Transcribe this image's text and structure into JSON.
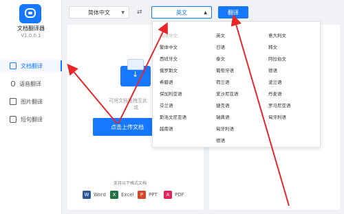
{
  "app": {
    "title": "文档翻译器",
    "version": "V1.0.0.1"
  },
  "sidebar": {
    "items": [
      {
        "label": "文档翻译",
        "icon": "document-icon",
        "active": true
      },
      {
        "label": "语音翻译",
        "icon": "microphone-icon",
        "active": false
      },
      {
        "label": "图片翻译",
        "icon": "image-icon",
        "active": false
      },
      {
        "label": "短句翻译",
        "icon": "text-icon",
        "active": false
      }
    ]
  },
  "toolbar": {
    "source_lang": "简体中文",
    "target_lang": "英文",
    "swap_icon": "swap-arrows-icon",
    "translate_label": "翻译"
  },
  "upload": {
    "hint": "可将文档拖拽至此",
    "hint_suffix": "或",
    "button_label": "点击上传文档",
    "formats_title": "支持以下格式文档",
    "formats": [
      {
        "label": "Word",
        "color": "#2b579a",
        "glyph": "W"
      },
      {
        "label": "Excel",
        "color": "#217346",
        "glyph": "X"
      },
      {
        "label": "PPT",
        "color": "#d24726",
        "glyph": "P"
      },
      {
        "label": "PDF",
        "color": "#e0245e",
        "glyph": "A"
      }
    ]
  },
  "dropdown": {
    "columns": [
      [
        "简体中文",
        "繁体中文",
        "西班牙文",
        "俄罗斯文",
        "希腊语",
        "保加利亚语",
        "芬兰语",
        "斯洛文尼亚语",
        "越南语"
      ],
      [
        "英文",
        "日语",
        "泰文",
        "葡萄牙语",
        "荷兰语",
        "爱沙尼亚语",
        "捷克语",
        "瑞典语",
        "匈牙利语",
        "德语"
      ],
      [
        "意大利文",
        "韩文",
        "阿拉伯文",
        "德语",
        "波兰语",
        "丹麦语",
        "罗马尼亚语",
        "匈牙利语"
      ]
    ]
  },
  "colors": {
    "accent": "#1677ff",
    "arrow": "#e8262a"
  }
}
